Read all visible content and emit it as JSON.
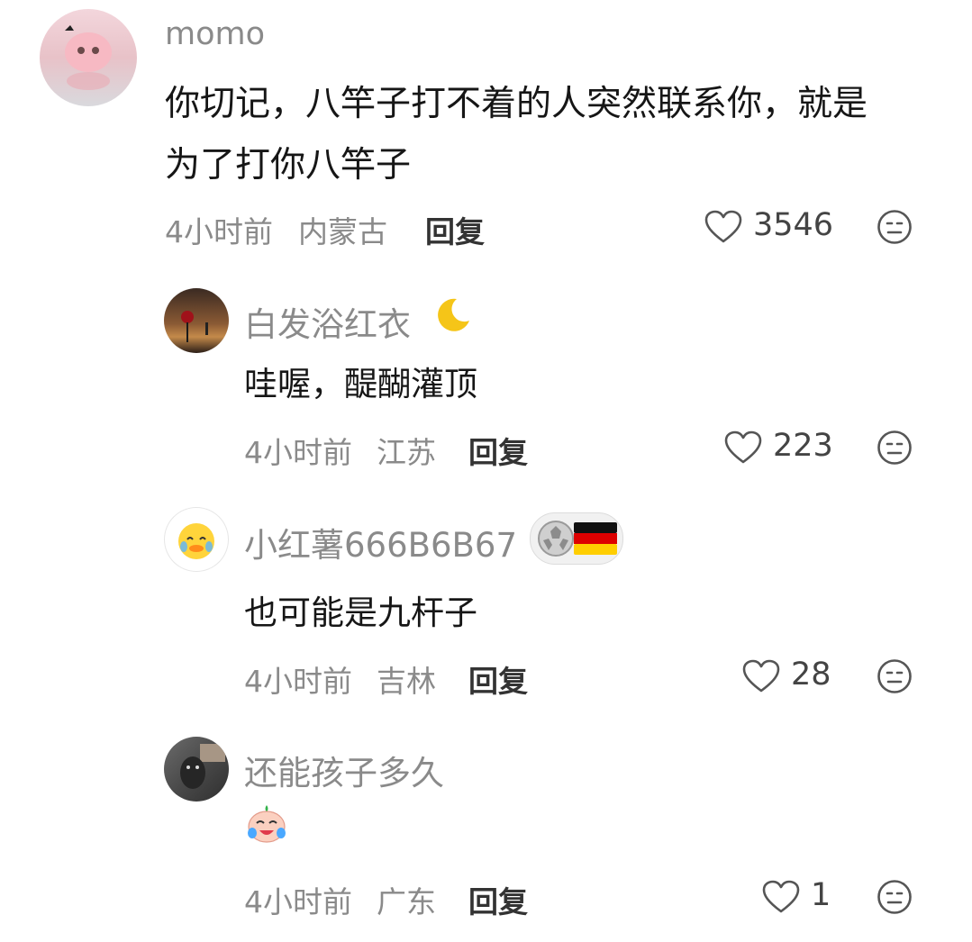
{
  "comments": [
    {
      "username": "momo",
      "text_lines": [
        "你切记，八竿子打不着的人突然联系你，就是",
        "为了打你八竿子"
      ],
      "time": "4小时前",
      "location": "内蒙古",
      "reply_label": "回复",
      "likes": "3546"
    },
    {
      "username": "白发浴红衣",
      "text_lines": [
        "哇喔，醍醐灌顶"
      ],
      "time": "4小时前",
      "location": "江苏",
      "reply_label": "回复",
      "likes": "223"
    },
    {
      "username": "小红薯666B6B67",
      "text_lines": [
        "也可能是九杆子"
      ],
      "time": "4小时前",
      "location": "吉林",
      "reply_label": "回复",
      "likes": "28"
    },
    {
      "username": "还能孩子多久",
      "text_lines": [],
      "time": "4小时前",
      "location": "广东",
      "reply_label": "回复",
      "likes": "1"
    }
  ],
  "icons": {
    "like": "heart-outline-icon",
    "dislike": "meh-face-icon",
    "moon": "crescent-moon-icon",
    "emoji": "crying-laughing-emoji",
    "flag": "germany-flag-badge"
  },
  "colors": {
    "meta_text": "#8a8a8a",
    "body_text": "#161616",
    "icon_stroke": "#555555"
  }
}
